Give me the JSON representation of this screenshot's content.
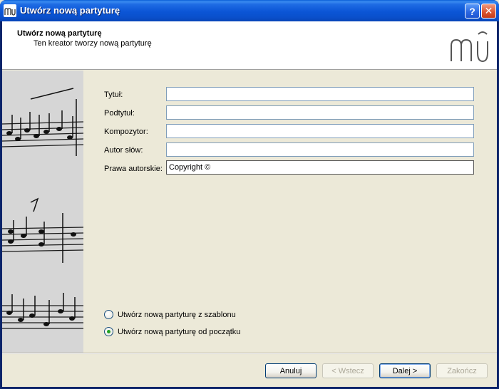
{
  "window": {
    "title": "Utwórz nową partyturę",
    "help_label": "?",
    "close_label": "✕"
  },
  "header": {
    "title": "Utwórz nową partyturę",
    "subtitle": "Ten kreator tworzy nową partyturę"
  },
  "form": {
    "fields": [
      {
        "label": "Tytuł:",
        "value": ""
      },
      {
        "label": "Podtytuł:",
        "value": ""
      },
      {
        "label": "Kompozytor:",
        "value": ""
      },
      {
        "label": "Autor słów:",
        "value": ""
      },
      {
        "label": "Prawa autorskie:",
        "value": "Copyright ©"
      }
    ]
  },
  "options": [
    {
      "label": "Utwórz nową partyturę z szablonu",
      "checked": false
    },
    {
      "label": "Utwórz nową partyturę od początku",
      "checked": true
    }
  ],
  "buttons": {
    "cancel": "Anuluj",
    "back": "< Wstecz",
    "next": "Dalej >",
    "finish": "Zakończ"
  },
  "colors": {
    "titlebar": "#0A50CC",
    "radio_checked": "#21A121"
  }
}
